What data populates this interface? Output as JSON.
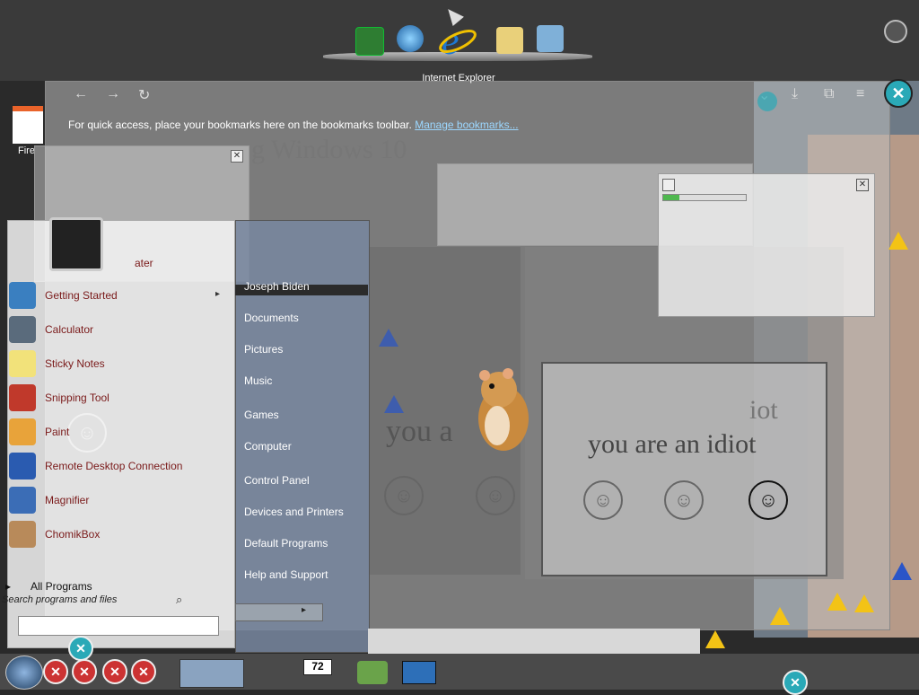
{
  "dock": {
    "caption": "Internet Explorer",
    "icons": [
      "excel-icon",
      "globe-icon",
      "internet-explorer-icon",
      "mail-icon",
      "people-icon"
    ]
  },
  "firefox": {
    "bookmarks_message": "For quick access, place your bookmarks here on the bookmarks toolbar.",
    "manage_bookmarks_link": "Manage bookmarks...",
    "close_symbol": "✕"
  },
  "background": {
    "heading_fragment": "g Windows 10",
    "idiot_text_1": "you a",
    "idiot_text_2": "you are an idiot",
    "idiot_text_3": "iot",
    "smiley": "☺"
  },
  "desktop": {
    "firefox_label": "Fire"
  },
  "start_menu": {
    "partial_item": "ater",
    "programs": [
      {
        "label": "Getting Started",
        "icon": "getting-started-icon",
        "has_submenu": true,
        "color": "#3a7fc0"
      },
      {
        "label": "Calculator",
        "icon": "calculator-icon",
        "has_submenu": false,
        "color": "#5a6b7c"
      },
      {
        "label": "Sticky Notes",
        "icon": "sticky-notes-icon",
        "has_submenu": false,
        "color": "#f2e27a"
      },
      {
        "label": "Snipping Tool",
        "icon": "snipping-tool-icon",
        "has_submenu": false,
        "color": "#c0392b"
      },
      {
        "label": "Paint",
        "icon": "paint-icon",
        "has_submenu": false,
        "color": "#e8a33a"
      },
      {
        "label": "Remote Desktop Connection",
        "icon": "remote-desktop-icon",
        "has_submenu": false,
        "color": "#2a5bb0"
      },
      {
        "label": "Magnifier",
        "icon": "magnifier-icon",
        "has_submenu": false,
        "color": "#3b6db6"
      },
      {
        "label": "ChomikBox",
        "icon": "chomikbox-icon",
        "has_submenu": false,
        "color": "#b88a5a"
      }
    ],
    "all_programs": "All Programs",
    "search_placeholder": "Search programs and files",
    "right_items": [
      "Joseph Biden",
      "Documents",
      "Pictures",
      "Music",
      "Games",
      "Computer",
      "Control Panel",
      "Devices and Printers",
      "Default Programs",
      "Help and Support"
    ]
  },
  "taskbar": {
    "clock_fragment": "72"
  }
}
